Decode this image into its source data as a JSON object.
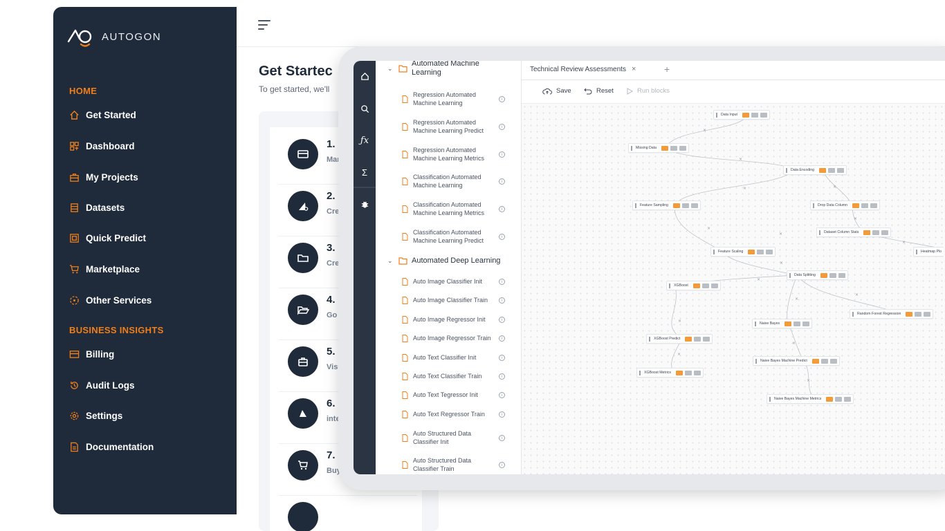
{
  "brand": {
    "name": "AUTOGON"
  },
  "sidebar": {
    "sections": [
      {
        "title": "HOME"
      },
      {
        "title": "BUSINESS INSIGHTS"
      }
    ],
    "items": [
      {
        "label": "Get Started",
        "icon": "home-icon"
      },
      {
        "label": "Dashboard",
        "icon": "dashboard-icon"
      },
      {
        "label": "My Projects",
        "icon": "briefcase-icon"
      },
      {
        "label": "Datasets",
        "icon": "dataset-icon"
      },
      {
        "label": "Quick Predict",
        "icon": "predict-icon"
      },
      {
        "label": "Marketplace",
        "icon": "cart-icon"
      },
      {
        "label": "Other Services",
        "icon": "services-icon"
      },
      {
        "label": "Billing",
        "icon": "card-icon"
      },
      {
        "label": "Audit Logs",
        "icon": "history-icon"
      },
      {
        "label": "Settings",
        "icon": "gear-icon"
      },
      {
        "label": "Documentation",
        "icon": "document-icon"
      }
    ]
  },
  "main": {
    "title": "Get Startec",
    "subtitle": "To get started, we'll",
    "steps": [
      {
        "num": "1.",
        "desc": "Mar"
      },
      {
        "num": "2.",
        "desc": "Cre"
      },
      {
        "num": "3.",
        "desc": "Cre"
      },
      {
        "num": "4.",
        "desc": "Go"
      },
      {
        "num": "5.",
        "desc": "Visu"
      },
      {
        "num": "6.",
        "desc": "inte"
      },
      {
        "num": "7.",
        "desc": "Buy a"
      }
    ]
  },
  "workflow": {
    "tab_title": "Technical Review Assessments",
    "tab_close": "×",
    "tab_add": "+",
    "toolbar": {
      "save": "Save",
      "reset": "Reset",
      "run": "Run blocks"
    },
    "groups": [
      {
        "label": "Automated Machine Learning"
      },
      {
        "label": "Automated Deep Learning"
      }
    ],
    "ml_blocks": [
      "Regression Automated Machine Learning",
      "Regression Automated Machine Learning Predict",
      "Regression Automated Machine Learning Metrics",
      "Classification Automated Machine Learning",
      "Classification Automated Machine Learning Metrics",
      "Classification Automated Machine Learning Predict"
    ],
    "dl_blocks": [
      "Auto Image Classifier Init",
      "Auto Image Classifier Train",
      "Auto Image Regressor Init",
      "Auto Image Regressor Train",
      "Auto Text Classifier Init",
      "Auto Text Classifier Train",
      "Auto Text Tegressor Init",
      "Auto Text Regressor Train",
      "Auto Structured Data Classifier Init",
      "Auto Structured Data Classifier Train"
    ],
    "nodes": [
      "Data Input",
      "Missing Data",
      "Data Encoding",
      "Feature Sampling",
      "Drop Data Column",
      "Dataset Column Stats",
      "Heatmap Plo",
      "Feature Scaling",
      "Data Splitting",
      "XGBoost",
      "Random Forest Regression",
      "Naive Bayes",
      "XGBoost Predict",
      "Naive Bayes Machine Predict",
      "XGBoost Metrics",
      "Naive Bayes Machine Metrics"
    ]
  },
  "colors": {
    "accent": "#f07f1a",
    "sidebar_bg": "#1f2a3a",
    "rail_bg": "#2b3443"
  }
}
